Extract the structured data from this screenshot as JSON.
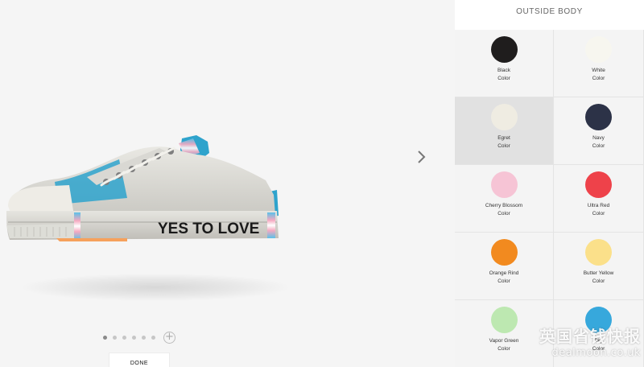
{
  "preview": {
    "shoe_text": "YES TO LOVE",
    "view_dots": 6,
    "active_dot": 0,
    "add_view_symbol": "+",
    "next_icon": "chevron-right-icon"
  },
  "actions": {
    "done_label": "DONE"
  },
  "panel": {
    "title": "OUTSIDE BODY",
    "swatches": [
      {
        "name": "Black",
        "sub": "Color",
        "color": "#1f1d1d",
        "selected": false
      },
      {
        "name": "White",
        "sub": "Color",
        "color": "#f7f6ef",
        "selected": false
      },
      {
        "name": "Egret",
        "sub": "Color",
        "color": "#efece2",
        "selected": true
      },
      {
        "name": "Navy",
        "sub": "Color",
        "color": "#2c3247",
        "selected": false
      },
      {
        "name": "Cherry Blossom",
        "sub": "Color",
        "color": "#f6c4d5",
        "selected": false
      },
      {
        "name": "Ultra Red",
        "sub": "Color",
        "color": "#ee424a",
        "selected": false
      },
      {
        "name": "Orange Rind",
        "sub": "Color",
        "color": "#f28a1f",
        "selected": false
      },
      {
        "name": "Butter Yellow",
        "sub": "Color",
        "color": "#fbe08a",
        "selected": false
      },
      {
        "name": "Vapor Green",
        "sub": "Color",
        "color": "#bde8b1",
        "selected": false
      },
      {
        "name": "Sky",
        "sub": "Color",
        "color": "#37a8dc",
        "selected": false
      }
    ]
  },
  "watermark": {
    "line1": "英国省钱快报",
    "line2": "dealmoon.co.uk"
  }
}
